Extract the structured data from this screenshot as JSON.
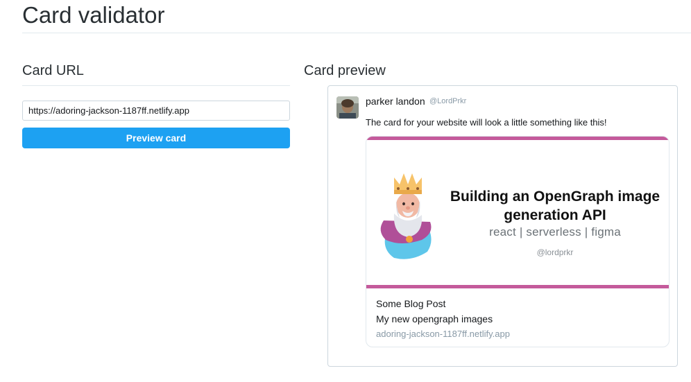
{
  "page": {
    "title": "Card validator"
  },
  "form": {
    "heading": "Card URL",
    "url_value": "https://adoring-jackson-1187ff.netlify.app",
    "button_label": "Preview card"
  },
  "preview": {
    "heading": "Card preview",
    "tweet": {
      "author_name": "parker landon",
      "author_handle": "@LordPrkr",
      "text": "The card for your website will look a little something like this!"
    },
    "card": {
      "image": {
        "title": "Building an OpenGraph image generation API",
        "tags": "react | serverless | figma",
        "handle": "@lordprkr",
        "accent_color": "#c45a9b",
        "illustration": "king-icon"
      },
      "title": "Some Blog Post",
      "description": "My new opengraph images",
      "domain": "adoring-jackson-1187ff.netlify.app"
    }
  },
  "colors": {
    "button": "#1da1f2",
    "border": "#ccd6dd"
  }
}
